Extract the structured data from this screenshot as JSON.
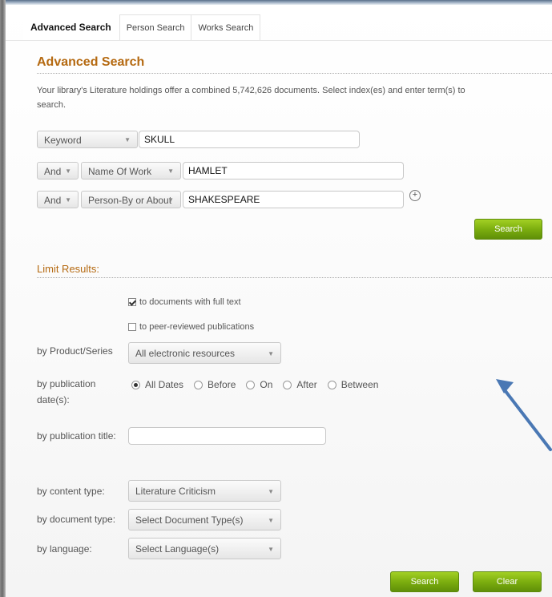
{
  "tabs": [
    {
      "label": "Advanced Search",
      "active": true
    },
    {
      "label": "Person Search",
      "active": false
    },
    {
      "label": "Works Search",
      "active": false
    }
  ],
  "heading": "Advanced Search",
  "intro": "Your library's Literature holdings offer a combined   5,742,626  documents. Select index(es) and enter term(s) to search.",
  "search_rows": [
    {
      "operator": "",
      "field": "Keyword",
      "term": "SKULL"
    },
    {
      "operator": "And",
      "field": "Name Of Work",
      "term": "HAMLET"
    },
    {
      "operator": "And",
      "field": "Person-By or About",
      "term": "SHAKESPEARE"
    }
  ],
  "add_row_icon": "plus-circle-icon",
  "search_button": "Search",
  "limit_heading": "Limit Results:",
  "full_text_checkbox": {
    "label": "to documents with full text",
    "checked": true
  },
  "peer_review_checkbox": {
    "label": "to peer-reviewed publications",
    "checked": false
  },
  "product_series": {
    "label": "by Product/Series",
    "value": "All electronic resources"
  },
  "publication_date": {
    "label": "by publication date(s):",
    "options": [
      "All Dates",
      "Before",
      "On",
      "After",
      "Between"
    ],
    "selected": "All Dates"
  },
  "publication_title": {
    "label": "by publication title:",
    "value": ""
  },
  "content_type": {
    "label": "by content type:",
    "value": "Literature Criticism"
  },
  "document_type": {
    "label": "by document type:",
    "value": "Select Document Type(s)"
  },
  "language": {
    "label": "by language:",
    "value": "Select Language(s)"
  },
  "bottom_search_button": "Search",
  "clear_button": "Clear",
  "colors": {
    "accent": "#b56a12",
    "button_green": "#7cae0f",
    "arrow_blue": "#4a78b4"
  }
}
